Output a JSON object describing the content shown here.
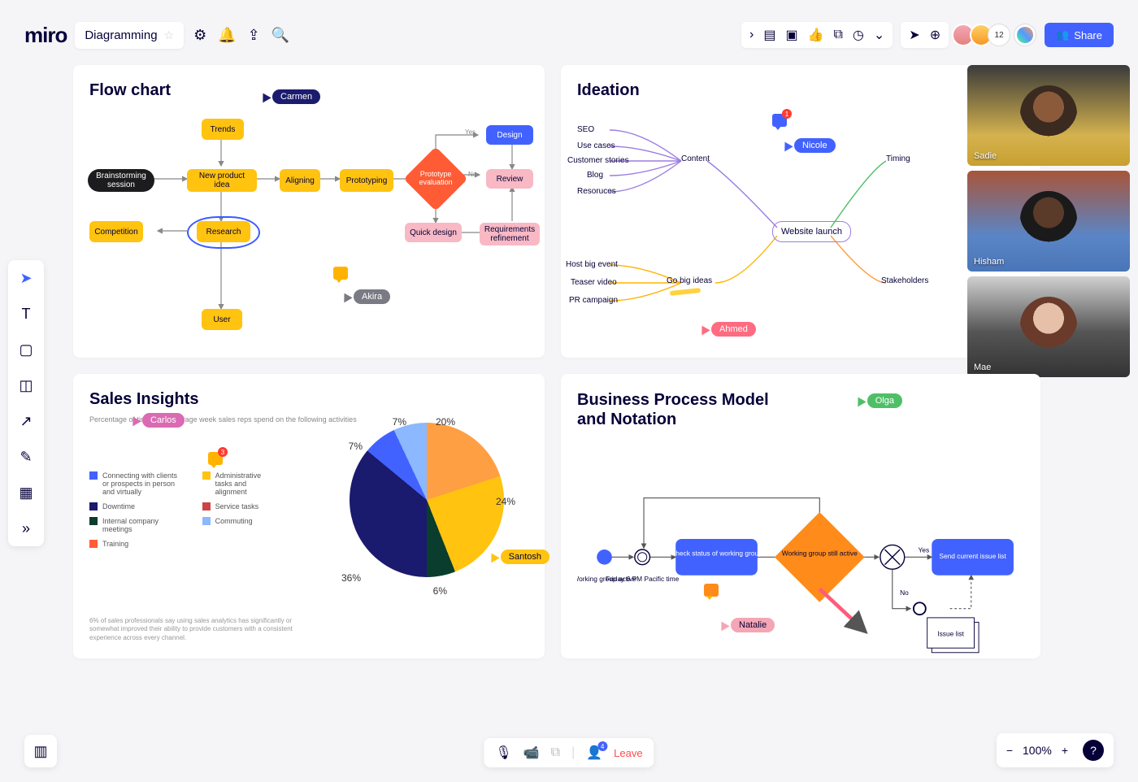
{
  "app": {
    "name": "miro",
    "board_title": "Diagramming"
  },
  "topbar": {
    "avatar_count": "12",
    "share_label": "Share"
  },
  "panels": {
    "flowchart": {
      "title": "Flow chart",
      "nodes": {
        "brainstorm": "Brainstorming session",
        "trends": "Trends",
        "new_product": "New product idea",
        "aligning": "Aligning",
        "prototyping": "Prototyping",
        "competition": "Competition",
        "research": "Research",
        "user": "User",
        "evaluation": "Prototype evaluation",
        "design": "Design",
        "review": "Review",
        "quick_design": "Quick design",
        "requirements": "Requirements refinement",
        "yes": "Yes",
        "no": "No"
      },
      "cursors": {
        "carmen": "Carmen",
        "akira": "Akira"
      }
    },
    "ideation": {
      "title": "Ideation",
      "center": "Website launch",
      "branches": {
        "content": "Content",
        "content_items": [
          "SEO",
          "Use cases",
          "Customer stories",
          "Blog",
          "Resoruces"
        ],
        "ideas": "Go big ideas",
        "ideas_items": [
          "Host big event",
          "Teaser video",
          "PR campaign"
        ],
        "timing": "Timing",
        "stakeholders": "Stakeholders"
      },
      "cursors": {
        "nicole": "Nicole",
        "ahmed": "Ahmed"
      },
      "comment_badge": "1"
    },
    "sales": {
      "title": "Sales Insights",
      "subtitle": "Percentage of time in an average week sales reps spend on the following activities",
      "legend": [
        {
          "color": "#4262ff",
          "label": "Connecting with clients or prospects in person and virtually"
        },
        {
          "color": "#1a1a6e",
          "label": "Downtime"
        },
        {
          "color": "#0b3d2e",
          "label": "Internal company meetings"
        },
        {
          "color": "#ff5c35",
          "label": "Training"
        },
        {
          "color": "#ffc310",
          "label": "Administrative tasks and alignment"
        },
        {
          "color": "#c44",
          "label": "Service tasks"
        },
        {
          "color": "#8bb8ff",
          "label": "Commuting"
        }
      ],
      "footnote": "6% of sales professionals say using sales analytics has significantly or somewhat improved their ability to provide customers with a consistent experience across every channel.",
      "cursors": {
        "carlos": "Carlos",
        "santosh": "Santosh"
      },
      "comment_badge": "3"
    },
    "bpmn": {
      "title": "Business Process Model and Notation",
      "nodes": {
        "start": "Working group active",
        "timer": "Friday 6 PM Pacific time",
        "check": "Check status of working group",
        "decision": "Working group still active",
        "send": "Send current issue list",
        "issue_list": "Issue list",
        "yes": "Yes",
        "no": "No"
      },
      "cursors": {
        "olga": "Olga",
        "natalie": "Natalie"
      }
    }
  },
  "videos": [
    {
      "name": "Sadie"
    },
    {
      "name": "Hisham"
    },
    {
      "name": "Mae"
    }
  ],
  "chart_data": {
    "type": "pie",
    "title": "Sales Insights",
    "slices": [
      {
        "label": "Connecting with clients or prospects in person and virtually",
        "value": 36,
        "color": "#4262ff"
      },
      {
        "label": "Administrative tasks and alignment",
        "value": 24,
        "color": "#ffc310"
      },
      {
        "label": "Downtime",
        "value": 20,
        "color": "#ff9f43"
      },
      {
        "label": "Commuting",
        "value": 7,
        "color": "#8bb8ff"
      },
      {
        "label": "Training",
        "value": 7,
        "color": "#1a1a6e"
      },
      {
        "label": "Internal company meetings",
        "value": 6,
        "color": "#0b3d2e"
      }
    ],
    "labels_pct": {
      "p20": "20%",
      "p24": "24%",
      "p6": "6%",
      "p36": "36%",
      "p7a": "7%",
      "p7b": "7%"
    }
  },
  "bottom": {
    "leave": "Leave",
    "zoom": "100%",
    "person_badge": "4"
  }
}
